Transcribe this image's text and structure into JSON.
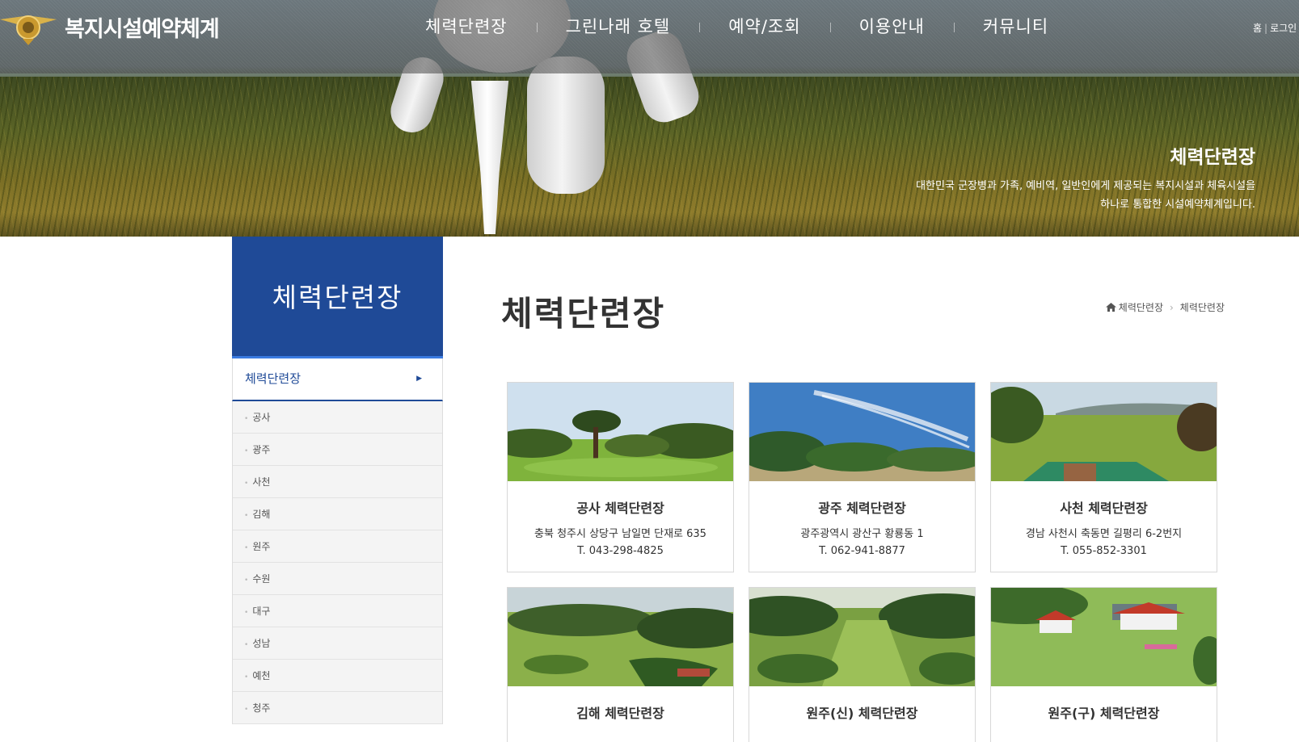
{
  "header": {
    "site_title": "복지시설예약체계",
    "nav": [
      "체력단련장",
      "그린나래 호텔",
      "예약/조회",
      "이용안내",
      "커뮤니티"
    ],
    "util": {
      "home": "홈",
      "login": "로그인"
    }
  },
  "hero": {
    "title": "체력단련장",
    "desc_line1": "대한민국 군장병과 가족, 예비역, 일반인에게 제공되는 복지시설과 체육시설을",
    "desc_line2": "하나로 통합한 시설예약체계입니다."
  },
  "sidebar": {
    "heading": "체력단련장",
    "active": "체력단련장",
    "items": [
      "공사",
      "광주",
      "사천",
      "김해",
      "원주",
      "수원",
      "대구",
      "성남",
      "예천",
      "청주"
    ]
  },
  "main": {
    "title": "체력단련장",
    "breadcrumb": [
      "체력단련장",
      "체력단련장"
    ]
  },
  "cards": [
    {
      "name": "공사 체력단련장",
      "addr": "충북 청주시 상당구 남일면 단재로 635",
      "tel": "T. 043-298-4825"
    },
    {
      "name": "광주 체력단련장",
      "addr": "광주광역시 광산구 황룡동 1",
      "tel": "T. 062-941-8877"
    },
    {
      "name": "사천 체력단련장",
      "addr": "경남 사천시 축동면 길평리 6-2번지",
      "tel": "T. 055-852-3301"
    },
    {
      "name": "김해 체력단련장",
      "addr": "",
      "tel": ""
    },
    {
      "name": "원주(신) 체력단련장",
      "addr": "",
      "tel": ""
    },
    {
      "name": "원주(구) 체력단련장",
      "addr": "",
      "tel": ""
    }
  ],
  "colors": {
    "primary": "#1f4a97",
    "accent": "#3a7ae0"
  }
}
